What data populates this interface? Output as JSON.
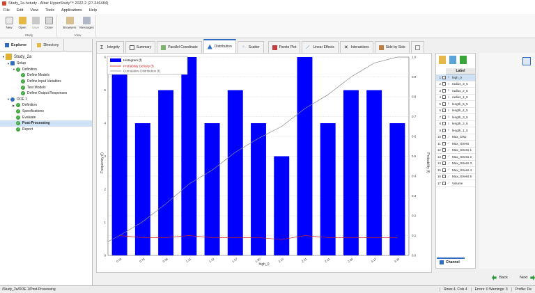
{
  "window": {
    "title": "Study_2a.hstudy - Altair HyperStudy™ 2022.2 (27.246484)"
  },
  "menu": [
    "File",
    "Edit",
    "View",
    "Tools",
    "Applications",
    "Help"
  ],
  "ribbon": {
    "study_group": "Study",
    "view_group": "View",
    "buttons": {
      "new": "New",
      "open": "Open",
      "save": "Save",
      "close": "Close",
      "browsers": "Browsers",
      "messages": "Messages"
    }
  },
  "left_panel": {
    "tabs": [
      "Explorer",
      "Directory"
    ],
    "tree": {
      "study": "Study_2a",
      "setup": "Setup",
      "definition": "Definition",
      "define_models": "Define Models",
      "define_input": "Define Input Variables",
      "test_models": "Test Models",
      "define_output": "Define Output Responses",
      "doe": "DOE 1",
      "doe_definition": "Definition",
      "specifications": "Specifications",
      "evaluate": "Evaluate",
      "post_processing": "Post-Processing",
      "report": "Report"
    }
  },
  "main_tabs": [
    "Integrity",
    "Summary",
    "Parallel Coordinate",
    "Distribution",
    "Scatter",
    "Pareto Plot",
    "Linear Effects",
    "Interactions",
    "Side by Side"
  ],
  "chart_data": {
    "type": "bar",
    "categories": [
      "0.49",
      "0.78",
      "0.98",
      "1.21",
      "1.32",
      "1.57",
      "1.80",
      "2.13",
      "2.31",
      "2.61",
      "2.85",
      "3.13",
      "3.39"
    ],
    "series": [
      {
        "name": "Histogram (f)",
        "values": [
          6,
          4,
          5,
          6,
          4,
          5,
          4,
          3,
          6,
          4,
          5,
          5,
          4
        ],
        "color": "#0000ff"
      },
      {
        "name": "Probability Density (f)",
        "values": [
          0.1,
          0.09,
          0.09,
          0.1,
          0.09,
          0.09,
          0.09,
          0.08,
          0.1,
          0.09,
          0.09,
          0.09,
          0.09
        ],
        "color": "#cc2222"
      },
      {
        "name": "Cumulative Distribution (f)",
        "values": [
          0.1,
          0.17,
          0.26,
          0.36,
          0.43,
          0.52,
          0.59,
          0.65,
          0.74,
          0.81,
          0.9,
          0.97,
          1.0
        ],
        "color": "#8a8a8a"
      }
    ],
    "xlabel": "high_0",
    "ylabel": "Frequency (f)",
    "y2label": "Probability (f)",
    "ylim": [
      0,
      6.0
    ],
    "y2lim": [
      0.0,
      1.0
    ],
    "yticks": [
      "0",
      "1",
      "2",
      "3",
      "4",
      "5",
      "6"
    ],
    "y2ticks": [
      "0.0",
      "0.1",
      "0.2",
      "0.3",
      "0.4",
      "0.5",
      "0.6",
      "0.7",
      "0.8",
      "0.9",
      "1.0"
    ],
    "grid": true,
    "legend": "top-left"
  },
  "right_panel": {
    "label_header": "Label",
    "rows": [
      {
        "num": "1",
        "label": "high_0"
      },
      {
        "num": "2",
        "label": "radius_3_5"
      },
      {
        "num": "3",
        "label": "radius_2_5"
      },
      {
        "num": "4",
        "label": "radius_1_5"
      },
      {
        "num": "5",
        "label": "length_5_5"
      },
      {
        "num": "6",
        "label": "length_4_5"
      },
      {
        "num": "7",
        "label": "length_3_5"
      },
      {
        "num": "8",
        "label": "length_2_5"
      },
      {
        "num": "9",
        "label": "length_1_5"
      },
      {
        "num": "10",
        "label": "Max_Disp"
      },
      {
        "num": "11",
        "label": "Max_Stress"
      },
      {
        "num": "12",
        "label": "Max_Stress 1"
      },
      {
        "num": "13",
        "label": "Max_Stress 2"
      },
      {
        "num": "14",
        "label": "Max_Stress 3"
      },
      {
        "num": "15",
        "label": "Max_Stress 4"
      },
      {
        "num": "16",
        "label": "Max_Stress 5"
      },
      {
        "num": "17",
        "label": "Volume"
      }
    ],
    "channel_tab": "Channel"
  },
  "nav": {
    "back": "Back",
    "next": "Next"
  },
  "status": {
    "path": "/Study_2a/DOE 1/Post-Processing",
    "rows_cols": "Rows 4, Cols 4",
    "errors": "Errors: 0 Warnings: 3",
    "profile": "Profile: De"
  },
  "colors": {
    "accent": "#2f6bc0",
    "bar": "#0000ff",
    "ok": "#3aa63a"
  }
}
